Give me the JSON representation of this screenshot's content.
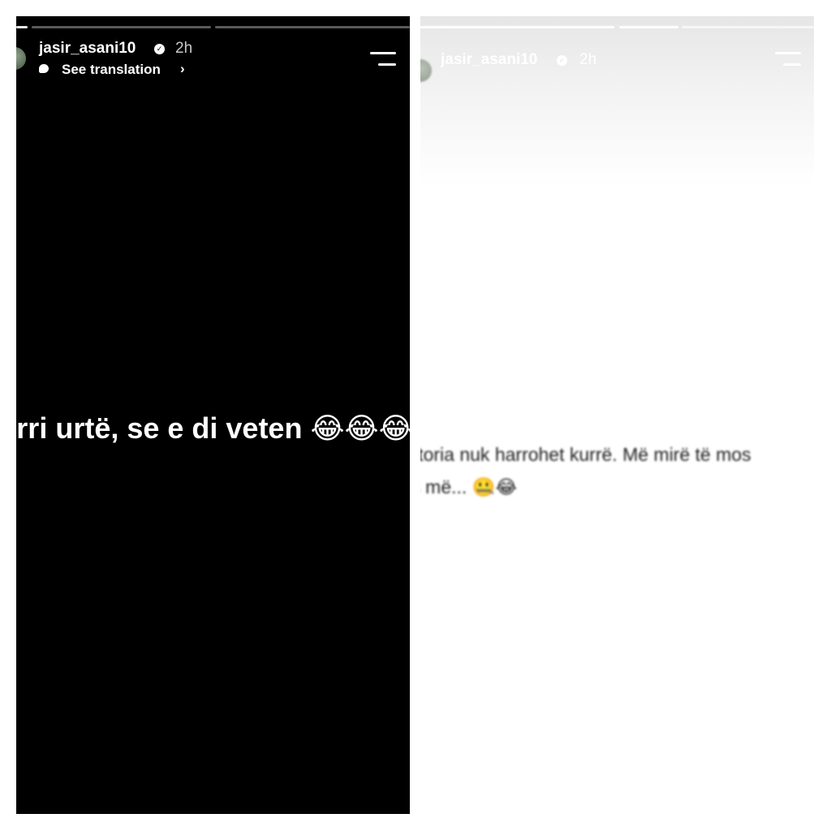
{
  "left_story": {
    "username": "jasir_asani10",
    "time": "2h",
    "see_translation": "See translation",
    "chevron": "›",
    "verified_icon": "verified-badge-icon",
    "menu_icon": "menu-icon",
    "text": "Po rri urtë, se e di veten 😂😂😂😂"
  },
  "right_story": {
    "username": "jasir_asani10",
    "time": "2h",
    "verified_icon": "verified-badge-icon",
    "menu_icon": "menu-icon",
    "text_line1": "Historia nuk harrohet kurrë. Më mirë të mos",
    "text_line2": "flas më... 🤐😂"
  },
  "colors": {
    "left_background": "#000000",
    "right_background": "#ffffff",
    "page_background": "#ffffff"
  }
}
